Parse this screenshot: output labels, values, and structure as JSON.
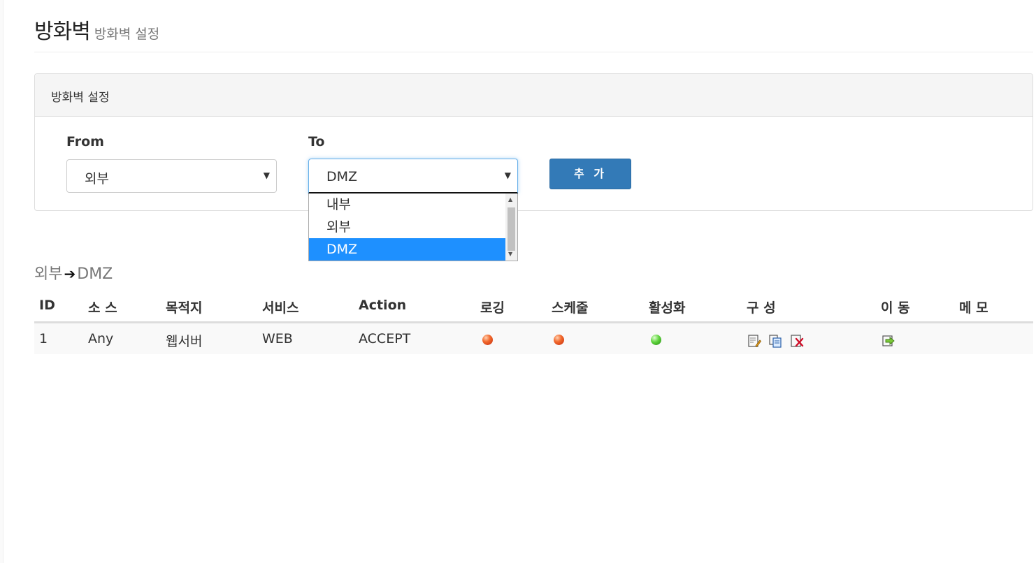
{
  "header": {
    "title": "방화벽",
    "subtitle": "방화벽 설정"
  },
  "panel": {
    "heading": "방화벽 설정",
    "from_label": "From",
    "to_label": "To",
    "from_value": "외부",
    "to_value": "DMZ",
    "add_button": "추 가",
    "to_options": [
      "내부",
      "외부",
      "DMZ"
    ],
    "to_selected": "DMZ"
  },
  "route": {
    "from": "외부",
    "to": "DMZ"
  },
  "table": {
    "headers": [
      "ID",
      "소 스",
      "목적지",
      "서비스",
      "Action",
      "로깅",
      "스케줄",
      "활성화",
      "구 성",
      "이 동",
      "메 모"
    ],
    "rows": [
      {
        "id": "1",
        "source": "Any",
        "destination": "웹서버",
        "service": "WEB",
        "action": "ACCEPT",
        "logging": "off",
        "schedule": "off",
        "enabled": "on",
        "config_icons": [
          "edit-icon",
          "copy-icon",
          "delete-icon"
        ],
        "move_icon": "move-icon",
        "memo": ""
      }
    ]
  },
  "colors": {
    "primary": "#337ab7",
    "selected_option": "#1e90ff",
    "status_off": "#e8401c",
    "status_on": "#3cb72a"
  }
}
